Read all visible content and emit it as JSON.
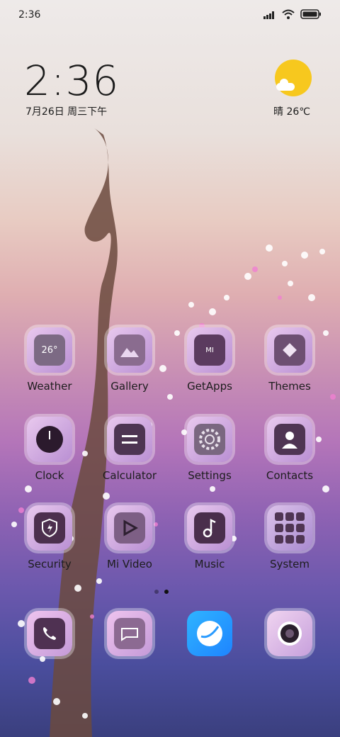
{
  "status_bar": {
    "time": "2:36"
  },
  "lockclock": {
    "time": "2:36",
    "date": "7月26日 周三下午"
  },
  "weather": {
    "text": "晴 26℃",
    "icon": "sun-with-cloud-icon",
    "sun_color": "#f7c81e"
  },
  "apps": [
    {
      "label": "Weather",
      "icon": "weather-icon",
      "badge": "26°"
    },
    {
      "label": "Gallery",
      "icon": "gallery-icon"
    },
    {
      "label": "GetApps",
      "icon": "shopping-bag-icon",
      "badge": "MI"
    },
    {
      "label": "Themes",
      "icon": "themes-icon"
    },
    {
      "label": "Clock",
      "icon": "clock-icon"
    },
    {
      "label": "Calculator",
      "icon": "calculator-icon"
    },
    {
      "label": "Settings",
      "icon": "settings-gear-icon"
    },
    {
      "label": "Contacts",
      "icon": "contacts-icon"
    },
    {
      "label": "Security",
      "icon": "security-shield-icon"
    },
    {
      "label": "Mi Video",
      "icon": "video-play-icon"
    },
    {
      "label": "Music",
      "icon": "music-note-icon"
    },
    {
      "label": "System",
      "icon": "system-folder-icon"
    }
  ],
  "dock": [
    {
      "icon": "phone-icon"
    },
    {
      "icon": "messaging-icon"
    },
    {
      "icon": "browser-icon"
    },
    {
      "icon": "camera-icon"
    }
  ],
  "pages": {
    "count": 2,
    "active": 1
  }
}
